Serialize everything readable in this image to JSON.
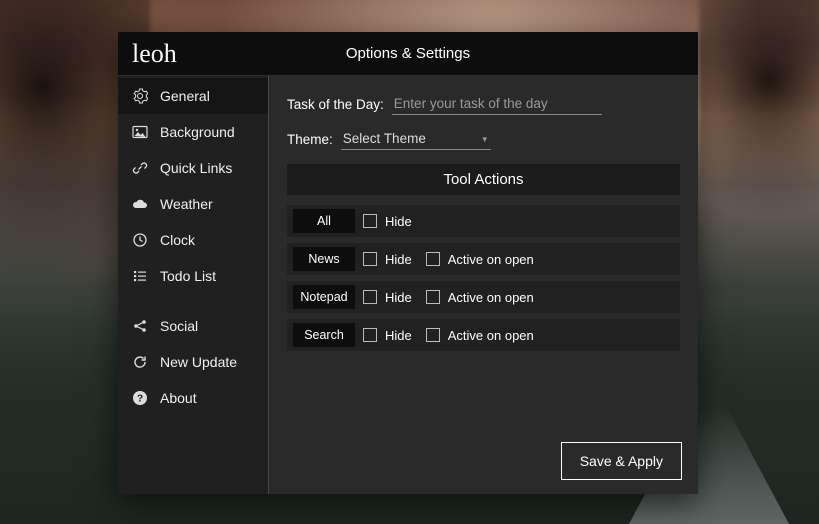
{
  "brand": "leoh",
  "title": "Options & Settings",
  "sidebar": {
    "items": [
      {
        "key": "general",
        "label": "General",
        "icon": "gear-icon"
      },
      {
        "key": "background",
        "label": "Background",
        "icon": "image-icon"
      },
      {
        "key": "quicklinks",
        "label": "Quick Links",
        "icon": "link-icon"
      },
      {
        "key": "weather",
        "label": "Weather",
        "icon": "cloud-icon"
      },
      {
        "key": "clock",
        "label": "Clock",
        "icon": "clock-icon"
      },
      {
        "key": "todo",
        "label": "Todo List",
        "icon": "list-icon"
      },
      {
        "key": "social",
        "label": "Social",
        "icon": "share-icon"
      },
      {
        "key": "update",
        "label": "New Update",
        "icon": "refresh-icon"
      },
      {
        "key": "about",
        "label": "About",
        "icon": "question-icon"
      }
    ]
  },
  "general": {
    "task_label": "Task of the Day:",
    "task_placeholder": "Enter your task of the day",
    "theme_label": "Theme:",
    "theme_selected": "Select Theme",
    "tool_actions_header": "Tool Actions",
    "hide_label": "Hide",
    "active_label": "Active on open",
    "tools": [
      {
        "name": "All",
        "has_active": false
      },
      {
        "name": "News",
        "has_active": true
      },
      {
        "name": "Notepad",
        "has_active": true
      },
      {
        "name": "Search",
        "has_active": true
      }
    ]
  },
  "footer": {
    "apply_label": "Save & Apply"
  }
}
